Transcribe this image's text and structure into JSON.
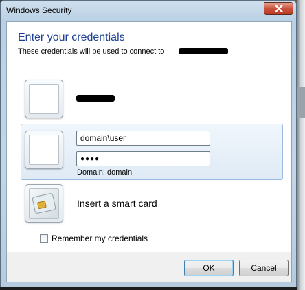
{
  "window": {
    "title": "Windows Security"
  },
  "header": {
    "heading": "Enter your credentials",
    "subheading": "These credentials will be used to connect to"
  },
  "tiles": {
    "saved_user": {
      "icon": "user-picture-flower-icon"
    },
    "credential": {
      "icon": "blank-user-tile-icon",
      "username_value": "domain\\user",
      "password_value": "●●●●",
      "domain_text": "Domain: domain"
    },
    "smartcard": {
      "icon": "smart-card-icon",
      "label": "Insert a smart card"
    }
  },
  "remember": {
    "label": "Remember my credentials",
    "checked": false
  },
  "buttons": {
    "ok": "OK",
    "cancel": "Cancel"
  },
  "colors": {
    "heading": "#1e3f94",
    "selection": "#dfeaf5",
    "close": "#c9523c"
  }
}
